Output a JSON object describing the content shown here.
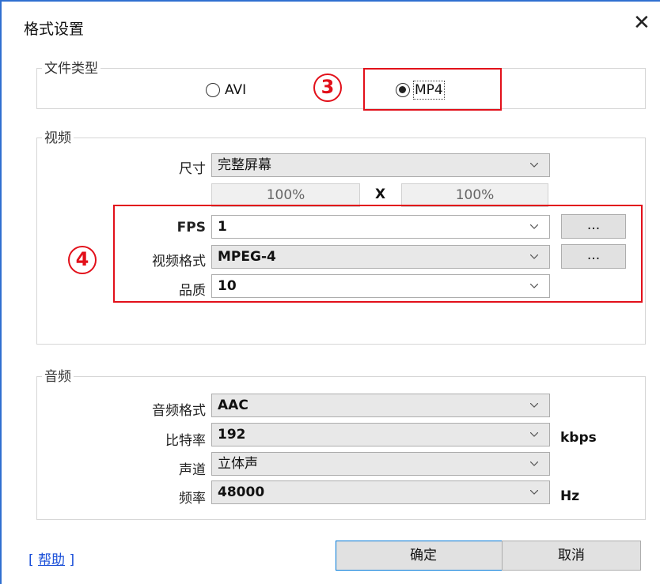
{
  "window": {
    "title": "格式设置"
  },
  "file_type": {
    "label": "文件类型",
    "options": [
      {
        "label": "AVI",
        "selected": false
      },
      {
        "label": "MP4",
        "selected": true
      }
    ]
  },
  "video": {
    "label": "视频",
    "size": {
      "label": "尺寸",
      "value": "完整屏幕"
    },
    "width_percent": "100%",
    "height_percent": "100%",
    "times_sign": "X",
    "fps": {
      "label": "FPS",
      "value": "1",
      "more": "..."
    },
    "format": {
      "label": "视频格式",
      "value": "MPEG-4",
      "more": "..."
    },
    "quality": {
      "label": "品质",
      "value": "10"
    }
  },
  "audio": {
    "label": "音频",
    "format": {
      "label": "音频格式",
      "value": "AAC"
    },
    "bitrate": {
      "label": "比特率",
      "value": "192",
      "unit": "kbps"
    },
    "channel": {
      "label": "声道",
      "value": "立体声"
    },
    "frequency": {
      "label": "频率",
      "value": "48000",
      "unit": "Hz"
    }
  },
  "footer": {
    "help_open": "[",
    "help_label": "帮助",
    "help_close": "]",
    "ok_label": "确定",
    "cancel_label": "取消"
  },
  "annotations": {
    "step3": "3",
    "step4": "4",
    "color": "#e2101a"
  }
}
